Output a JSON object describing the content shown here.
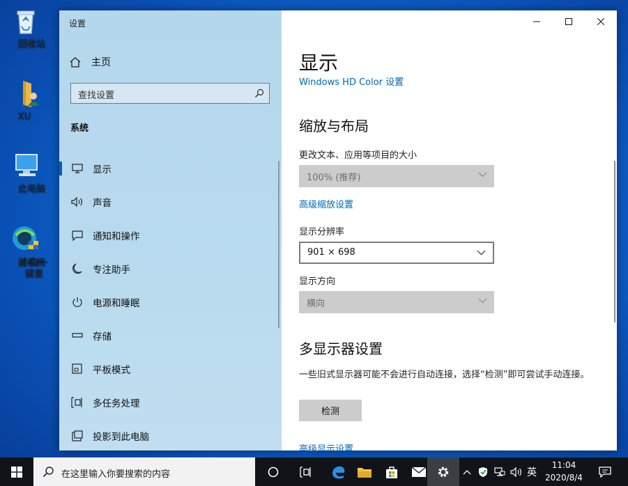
{
  "desktop": {
    "icons": [
      {
        "label": "回收站",
        "icon": "recycle-bin-icon"
      },
      {
        "label": "XU",
        "icon": "user-folder-icon"
      },
      {
        "label": "此电脑",
        "icon": "this-pc-icon"
      },
      {
        "label_line1": "小白一键重",
        "label_line2": "装系统",
        "icon": "installer-app-icon"
      }
    ]
  },
  "window": {
    "title": "设置",
    "sidebar": {
      "home_label": "主页",
      "search_placeholder": "查找设置",
      "section_label": "系统",
      "items": [
        {
          "label": "显示",
          "icon": "monitor-icon",
          "active": true
        },
        {
          "label": "声音",
          "icon": "speaker-icon"
        },
        {
          "label": "通知和操作",
          "icon": "notification-icon"
        },
        {
          "label": "专注助手",
          "icon": "moon-icon"
        },
        {
          "label": "电源和睡眠",
          "icon": "power-icon"
        },
        {
          "label": "存储",
          "icon": "storage-icon"
        },
        {
          "label": "平板模式",
          "icon": "tablet-icon"
        },
        {
          "label": "多任务处理",
          "icon": "multitask-icon"
        },
        {
          "label": "投影到此电脑",
          "icon": "project-icon"
        }
      ]
    },
    "main": {
      "page_title": "显示",
      "hd_color_link": "Windows HD Color 设置",
      "scale_section_title": "缩放与布局",
      "scale_label": "更改文本、应用等项目的大小",
      "scale_value": "100% (推荐)",
      "advanced_scale_link": "高级缩放设置",
      "resolution_label": "显示分辨率",
      "resolution_value": "901 × 698",
      "orientation_label": "显示方向",
      "orientation_value": "横向",
      "multi_section_title": "多显示器设置",
      "multi_desc": "一些旧式显示器可能不会进行自动连接，选择“检测”即可尝试手动连接。",
      "detect_button": "检测",
      "advanced_display_link": "高级显示设置"
    }
  },
  "taskbar": {
    "search_placeholder": "在这里输入你要搜索的内容",
    "language": "英",
    "time": "11:04",
    "date": "2020/8/4"
  },
  "colors": {
    "accent": "#0063b1",
    "link": "#0067b8",
    "sidebar_bg": "#b9daee",
    "taskbar_bg": "#101419",
    "disabled_dropdown": "#cccccc"
  }
}
